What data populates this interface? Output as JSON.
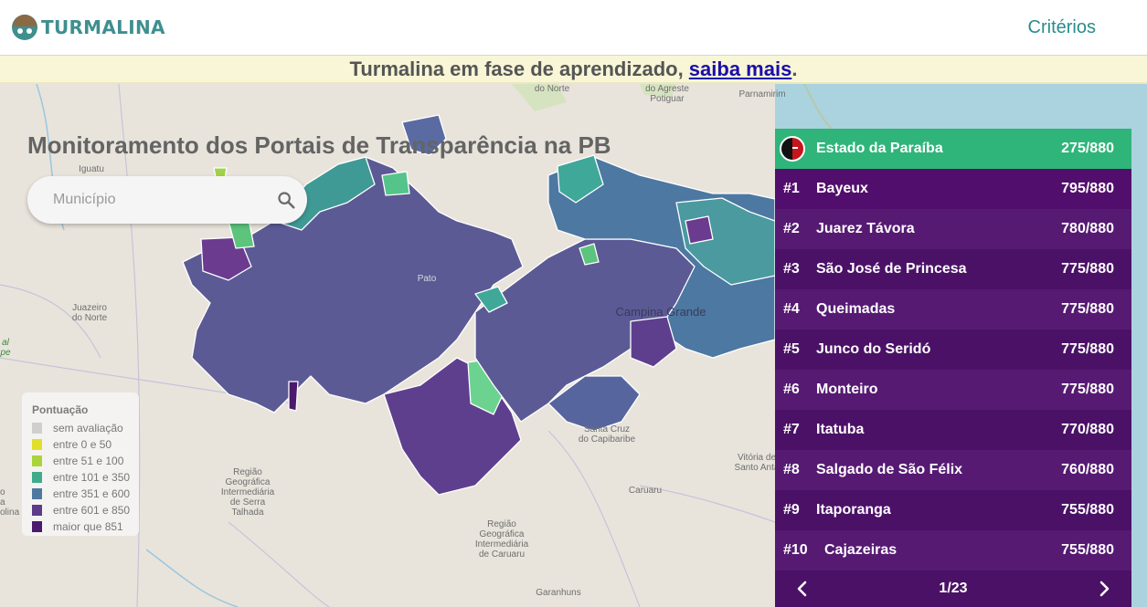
{
  "header": {
    "logo_text": "TURMALINA",
    "criteria_link": "Critérios"
  },
  "banner": {
    "text_before": "Turmalina em fase de aprendizado, ",
    "link_text": "saiba mais",
    "text_after": "."
  },
  "main": {
    "title": "Monitoramento dos Portais de Transparência na PB",
    "search": {
      "placeholder": "Município",
      "icon": "search-icon"
    }
  },
  "map_labels": {
    "do_norte": "do Norte",
    "agreste_potiguar": "do Agreste\nPotiguar",
    "parnamirim": "Parnamirim",
    "iguatu": "Iguatu",
    "juazeiro": "Juazeiro\ndo Norte",
    "pato": "Pato",
    "campina_grande": "Campina Grande",
    "santa_cruz": "Santa Cruz\ndo Capibaribe",
    "vitoria": "Vitória de\nSanto Antã",
    "serra_talhada": "Região\nGeográfica\nIntermediária\nde Serra\nTalhada",
    "caruaru_region": "Região\nGeográfica\nIntermediária\nde Caruaru",
    "caruaru": "Caruaru",
    "garanhuns": "Garanhuns",
    "left_edge": "al\npe",
    "left_edge2": "o\na\nolina"
  },
  "legend": {
    "title": "Pontuação",
    "items": [
      {
        "label": "sem avaliação",
        "color": "#cfcfcf"
      },
      {
        "label": "entre 0 e 50",
        "color": "#e2df2a"
      },
      {
        "label": "entre 51 e 100",
        "color": "#a9d43a"
      },
      {
        "label": "entre 101 e 350",
        "color": "#3faa8c"
      },
      {
        "label": "entre 351 e 600",
        "color": "#4f78a0"
      },
      {
        "label": "entre 601 e 850",
        "color": "#5d3a8a"
      },
      {
        "label": "maior que 851",
        "color": "#4b1a6c"
      }
    ]
  },
  "ranking": {
    "state": {
      "name": "Estado da Paraíba",
      "score": "275/880",
      "icon": "paraiba-flag-icon"
    },
    "items": [
      {
        "pos": "#1",
        "name": "Bayeux",
        "score": "795/880"
      },
      {
        "pos": "#2",
        "name": "Juarez Távora",
        "score": "780/880"
      },
      {
        "pos": "#3",
        "name": "São José de Princesa",
        "score": "775/880"
      },
      {
        "pos": "#4",
        "name": "Queimadas",
        "score": "775/880"
      },
      {
        "pos": "#5",
        "name": "Junco do Seridó",
        "score": "775/880"
      },
      {
        "pos": "#6",
        "name": "Monteiro",
        "score": "775/880"
      },
      {
        "pos": "#7",
        "name": "Itatuba",
        "score": "770/880"
      },
      {
        "pos": "#8",
        "name": "Salgado de São Félix",
        "score": "760/880"
      },
      {
        "pos": "#9",
        "name": "Itaporanga",
        "score": "755/880"
      },
      {
        "pos": "#10",
        "name": "Cajazeiras",
        "score": "755/880"
      }
    ],
    "pager": {
      "label": "1/23",
      "prev_icon": "chevron-left-icon",
      "next_icon": "chevron-right-icon"
    }
  },
  "colors": {
    "accent": "#2a8c8c",
    "state_row": "#2fb57a",
    "ranking_bg": "#4a1166",
    "ocean": "#aad3df",
    "land": "#e8e4dc"
  }
}
